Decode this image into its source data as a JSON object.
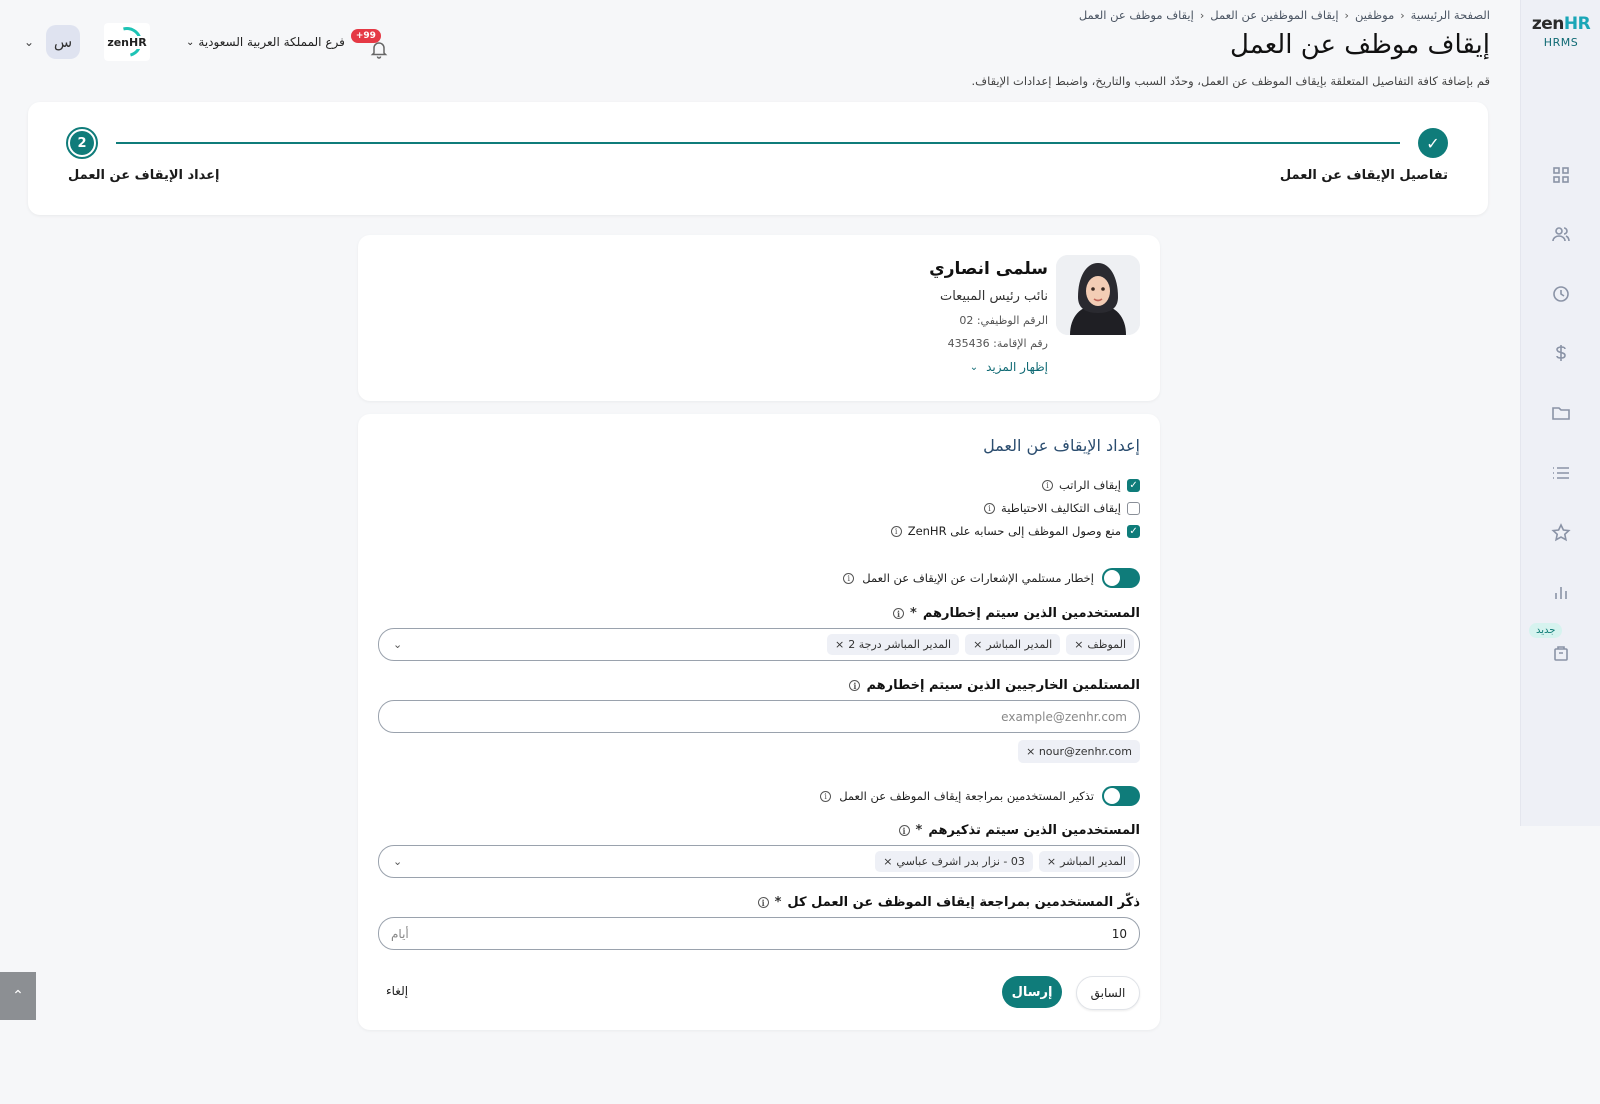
{
  "rail": {
    "brand_main": "zen",
    "brand_accent": "HR",
    "brand_sub": "HRMS",
    "new_badge": "جديد",
    "icons": [
      "dashboard-icon",
      "users-icon",
      "clock-icon",
      "dollar-icon",
      "folder-icon",
      "list-icon",
      "star-icon",
      "chart-icon",
      "bag-icon"
    ]
  },
  "header": {
    "avatar_initial": "س",
    "company_logo_text": "zenHR",
    "branch": "فرع المملكة العربية السعودية",
    "notifications": "+99",
    "breadcrumb": [
      "الصفحة الرئيسية",
      "موظفين",
      "إيقاف الموظفين عن العمل",
      "إيقاف موظف عن العمل"
    ],
    "title": "إيقاف موظف عن العمل",
    "description": "قم بإضافة كافة التفاصيل المتعلقة بإيقاف الموظف عن العمل، وحدّد السبب والتاريخ، واضبط إعدادات الإيقاف."
  },
  "stepper": {
    "step1_label": "تفاصيل الإيقاف عن العمل",
    "step2_label": "إعداد الإيقاف عن العمل",
    "step2_number": "2"
  },
  "employee": {
    "name": "سلمى انصاري",
    "role": "نائب رئيس المبيعات",
    "employee_id": "الرقم الوظيفي: 02",
    "iqama": "رقم الإقامة: 435436",
    "show_more": "إظهار المزيد"
  },
  "setup": {
    "title": "إعداد الإيقاف عن العمل",
    "checkboxes": [
      {
        "label": "إيقاف الراتب",
        "checked": true
      },
      {
        "label": "إيقاف التكاليف الاحتياطية",
        "checked": false
      },
      {
        "label": "منع وصول الموظف إلى حسابه على ZenHR",
        "checked": true
      }
    ],
    "notify_toggle_label": "إخطار مستلمي الإشعارات عن الإيقاف عن العمل",
    "notify_users_label": "المستخدمين الذين سيتم إخطارهم",
    "notify_users_chips": [
      "الموظف",
      "المدير المباشر",
      "المدير المباشر درجة 2"
    ],
    "external_label": "المستلمين الخارجيين الذين سيتم إخطارهم",
    "external_placeholder": "example@zenhr.com",
    "external_chip": "nour@zenhr.com",
    "remind_toggle_label": "تذكير المستخدمين بمراجعة إيقاف الموظف عن العمل",
    "remind_users_label": "المستخدمين الذين سيتم تذكيرهم",
    "remind_users_chips": [
      "المدير المباشر",
      "03 - نزار بدر اشرف عباسي"
    ],
    "remind_every_label": "ذكّر المستخدمين بمراجعة إيقاف الموظف عن العمل كل",
    "remind_every_value": "10",
    "remind_every_unit": "أيام",
    "required_mark": "*"
  },
  "actions": {
    "previous": "السابق",
    "send": "إرسال",
    "cancel": "إلغاء"
  },
  "colors": {
    "primary": "#0f7c7a",
    "accent": "#1aa6b7",
    "badge_red": "#e53945"
  }
}
